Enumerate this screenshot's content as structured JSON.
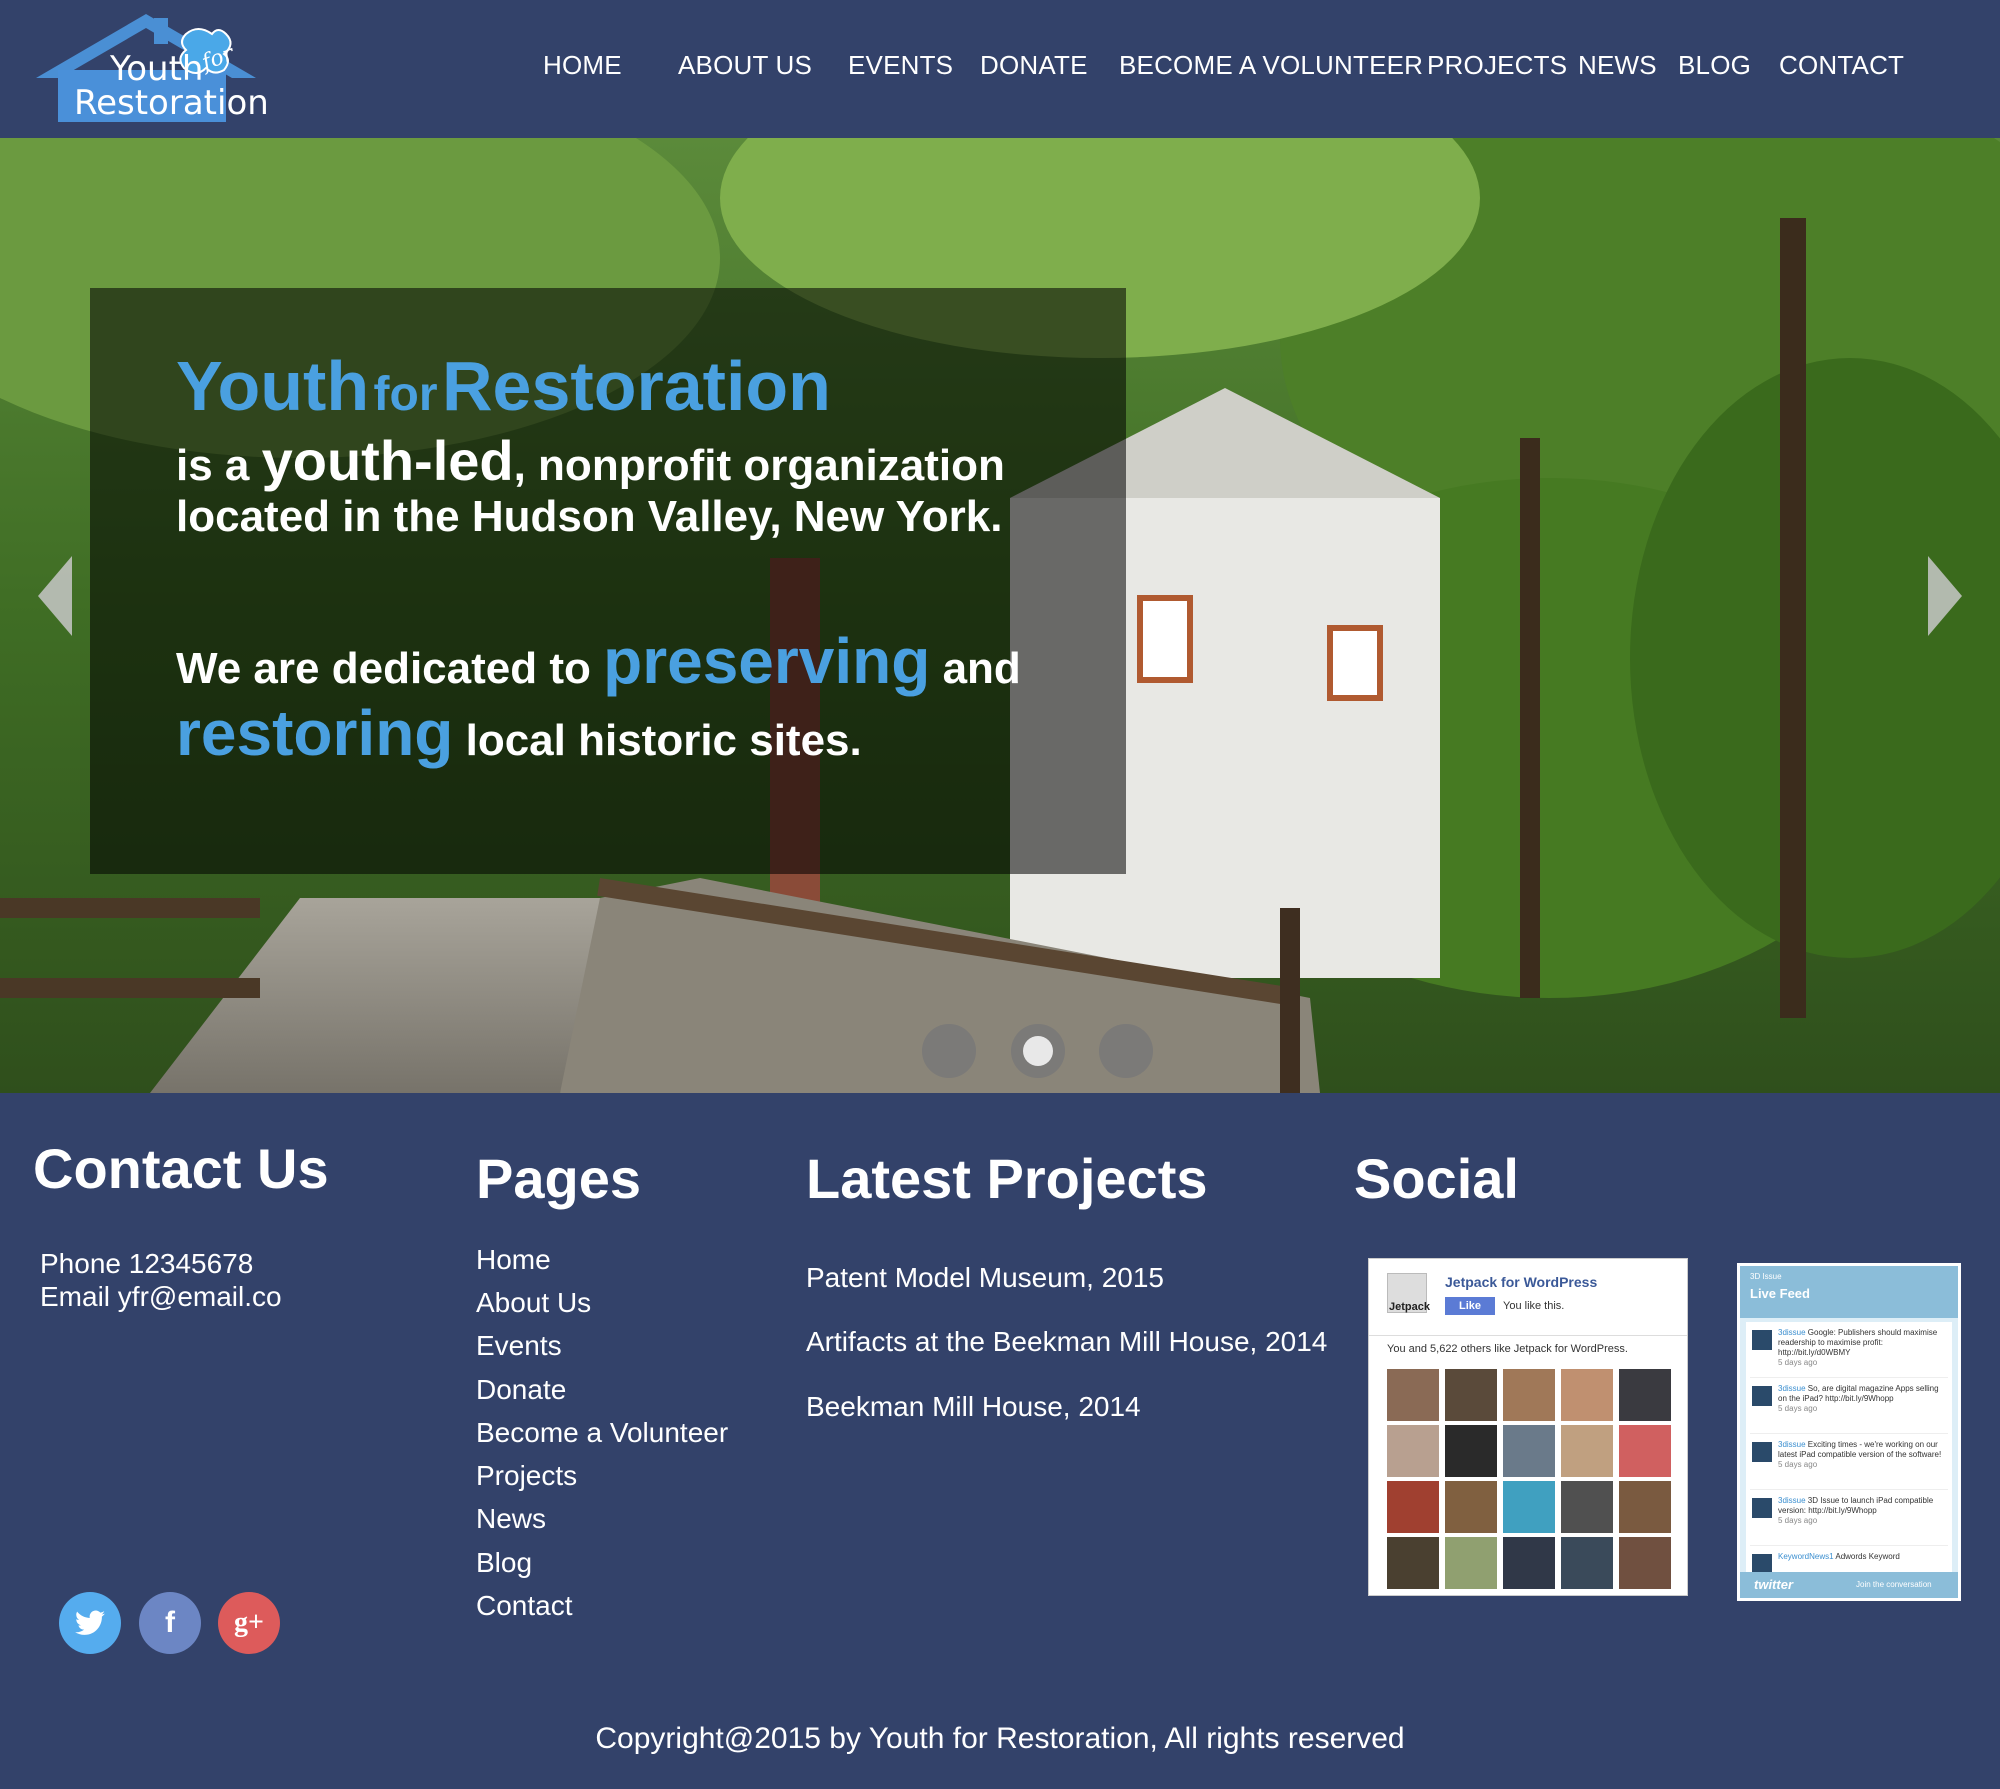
{
  "brand": {
    "logo_youth": "Youth",
    "logo_for": "for",
    "logo_restoration": "Restoration"
  },
  "nav": [
    "HOME",
    "ABOUT US",
    "EVENTS",
    "DONATE",
    "BECOME A VOLUNTEER",
    "PROJECTS",
    "NEWS",
    "BLOG",
    "CONTACT"
  ],
  "hero": {
    "title_youth": "Youth",
    "title_for": "for",
    "title_restoration": "Restoration",
    "line1_pre": "is a ",
    "line1_em": "youth-led",
    "line1_post": ", nonprofit  organization",
    "line2": "located in the Hudson Valley, New York.",
    "line3_pre": "We are dedicated to ",
    "line3_em": "preserving",
    "line3_post": " and",
    "line4_em": "restoring",
    "line4_post": " local historic sites.",
    "slides_total": 3,
    "active_slide": 2
  },
  "footer": {
    "contact_heading": "Contact Us",
    "phone": "Phone 12345678",
    "email": "Email yfr@email.co",
    "pages_heading": "Pages",
    "pages": [
      "Home",
      "About Us",
      "Events",
      "Donate",
      "Become a Volunteer",
      "Projects",
      "News",
      "Blog",
      "Contact"
    ],
    "projects_heading": "Latest Projects",
    "projects": [
      "Patent Model Museum, 2015",
      "Artifacts at the Beekman Mill House, 2014",
      "Beekman Mill House, 2014"
    ],
    "social_heading": "Social",
    "social_icons": [
      "twitter-icon",
      "facebook-icon",
      "google-plus-icon"
    ],
    "copyright": "Copyright@2015 by Youth for Restoration, All rights reserved"
  },
  "facebook_widget": {
    "page_name": "Jetpack for WordPress",
    "avatar_label": "Jetpack",
    "like_label": "Like",
    "you_like": "You like this.",
    "likes_text": "You and 5,622 others like Jetpack for WordPress."
  },
  "twitter_widget": {
    "header_small": "3D Issue",
    "header": "Live Feed",
    "tweets": [
      {
        "user": "3dissue",
        "text": "Google: Publishers should maximise readership to maximise profit: http://bit.ly/d0WBMY",
        "time": "5 days ago"
      },
      {
        "user": "3dissue",
        "text": "So, are digital magazine Apps selling on the iPad? http://bit.ly/9Whopp",
        "time": "5 days ago"
      },
      {
        "user": "3dissue",
        "text": "Exciting times - we're working on our latest iPad compatible version of the software!",
        "time": "5 days ago"
      },
      {
        "user": "3dissue",
        "text": "3D Issue to launch iPad compatible version: http://bit.ly/9Whopp",
        "time": "5 days ago"
      },
      {
        "user": "KeywordNews1",
        "text": "Adwords Keyword",
        "time": ""
      }
    ],
    "footer_brand": "twitter",
    "footer_join": "Join the conversation"
  },
  "colors": {
    "navy": "#33426a",
    "accent_blue": "#4aa0e0",
    "twitter": "#55acee",
    "facebook": "#6c86c4",
    "google": "#dd5b5b"
  }
}
